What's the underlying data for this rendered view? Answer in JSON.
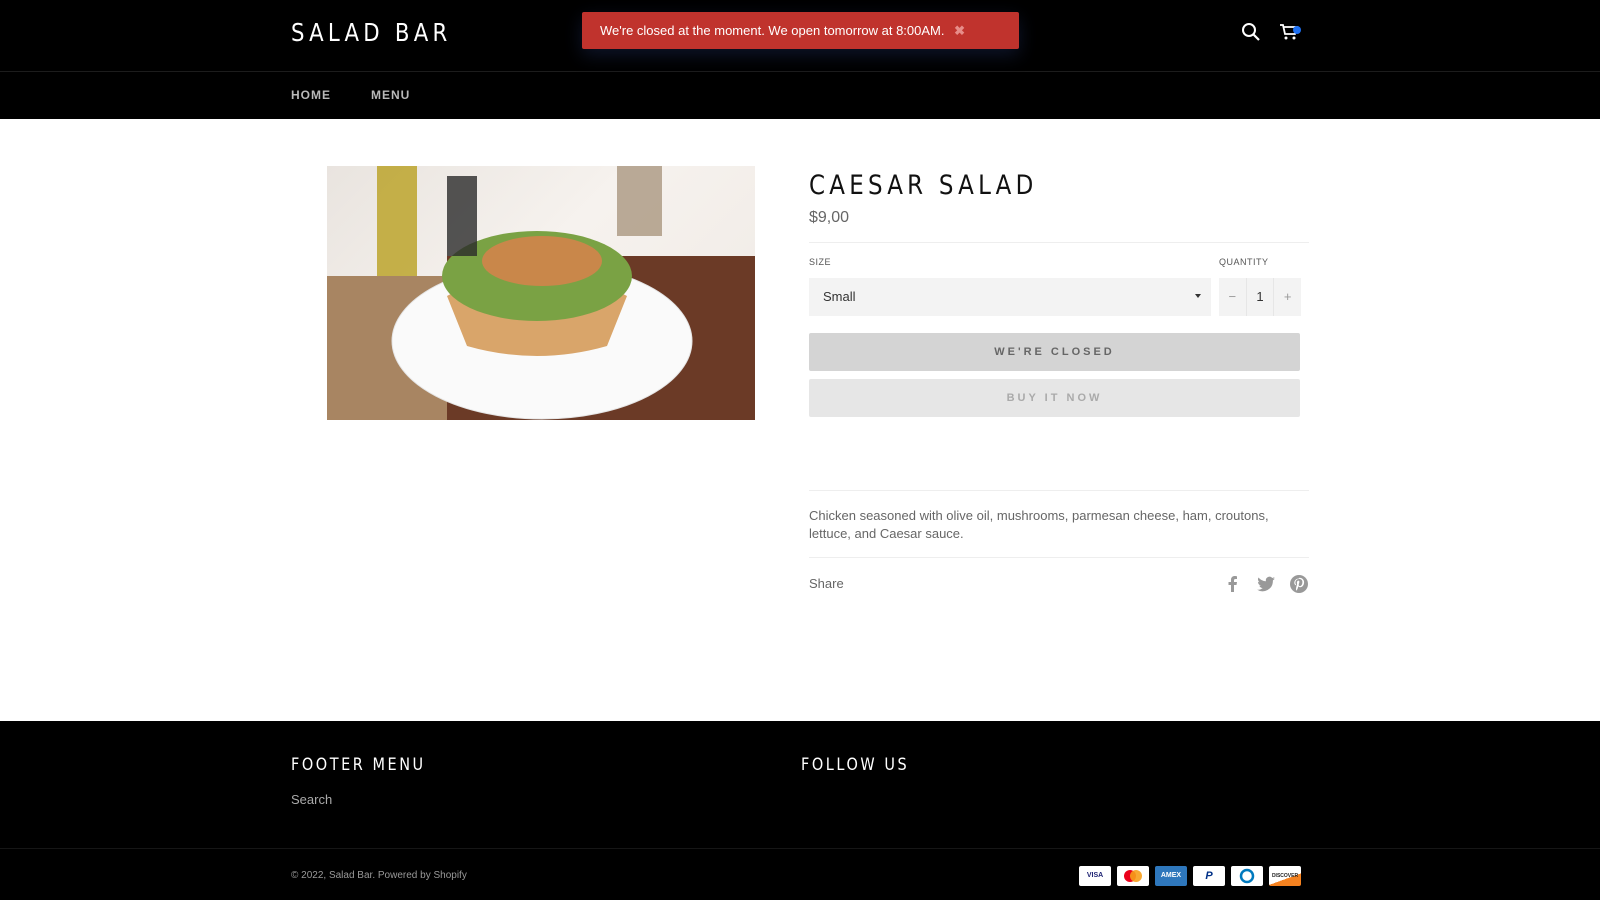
{
  "header": {
    "logo": "SALAD BAR",
    "notice": "We're closed at the moment. We open tomorrow at 8:00AM.",
    "notice_close": "✖",
    "nav": [
      "HOME",
      "MENU"
    ],
    "icons": [
      "search-icon",
      "cart-icon"
    ]
  },
  "product": {
    "title": "CAESAR SALAD",
    "price": "$9,00",
    "size_label": "SIZE",
    "size_value": "Small",
    "quantity_label": "QUANTITY",
    "quantity_value": "1",
    "qty_minus": "−",
    "qty_plus": "+",
    "closed_button": "WE'RE CLOSED",
    "buy_button": "BUY IT NOW",
    "description": "Chicken seasoned with olive oil, mushrooms, parmesan cheese, ham, croutons, lettuce, and Caesar sauce.",
    "share_label": "Share",
    "share_icons": [
      "facebook-icon",
      "twitter-icon",
      "pinterest-icon"
    ]
  },
  "footer": {
    "menu_heading": "FOOTER MENU",
    "menu_links": [
      "Search"
    ],
    "follow_heading": "FOLLOW US",
    "copyright_prefix": "© 2022, ",
    "copyright_store": "Salad Bar",
    "copyright_sep": ". ",
    "powered": "Powered by Shopify",
    "payments": [
      "VISA",
      "Mastercard",
      "AMEX",
      "PayPal",
      "Diners",
      "DISCOVER"
    ]
  },
  "colors": {
    "notice_bg": "#c0332d",
    "header_bg": "#000000",
    "cart_badge": "#1d6ff2"
  }
}
